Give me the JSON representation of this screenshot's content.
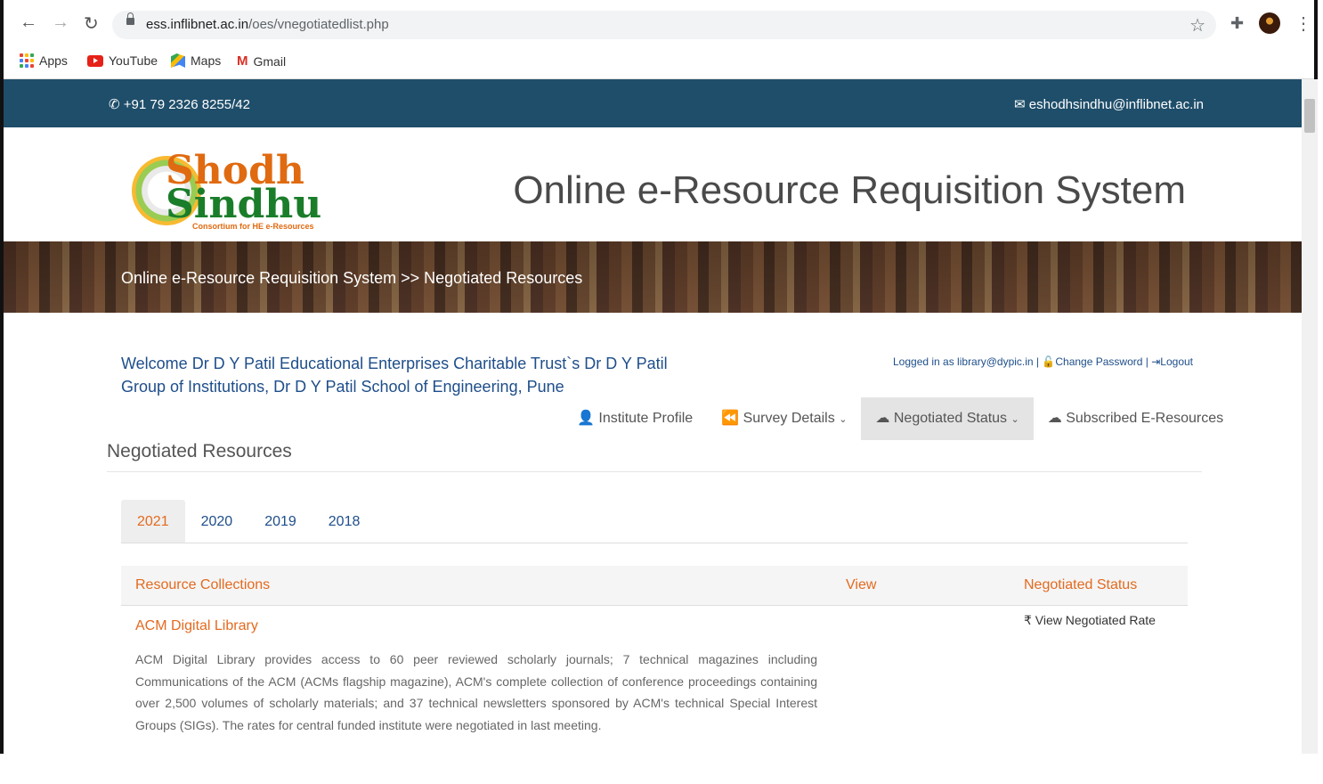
{
  "browser": {
    "url_domain": "ess.inflibnet.ac.in",
    "url_path": "/oes/vnegotiatedlist.php",
    "bookmarks": [
      "Apps",
      "YouTube",
      "Maps",
      "Gmail"
    ]
  },
  "topbar": {
    "phone": "+91 79 2326 8255/42",
    "email": "eshodhsindhu@inflibnet.ac.in"
  },
  "header": {
    "logo_primary": "Shodh",
    "logo_secondary": "Sindhu",
    "logo_sub": "Consortium for HE e-Resources",
    "site_title": "Online e-Resource Requisition System"
  },
  "breadcrumb": "Online e-Resource Requisition System >> Negotiated Resources",
  "welcome": "Welcome Dr D Y Patil Educational Enterprises Charitable Trust`s Dr D Y Patil Group of Institutions, Dr D Y Patil School of Engineering, Pune",
  "userlinks": {
    "logged_in": "Logged in as library@dypic.in |",
    "change_password": "Change Password",
    "separator": "|",
    "logout": "Logout"
  },
  "menu": [
    "Institute Profile",
    "Survey Details",
    "Negotiated Status",
    "Subscribed E-Resources"
  ],
  "section_title": "Negotiated Resources",
  "tabs": [
    "2021",
    "2020",
    "2019",
    "2018"
  ],
  "table": {
    "headers": [
      "Resource Collections",
      "View",
      "Negotiated Status"
    ],
    "rows": [
      {
        "name": "ACM Digital Library",
        "description": "ACM Digital Library provides access to 60 peer reviewed scholarly journals; 7 technical magazines including Communications of the ACM (ACMs flagship magazine), ACM's complete collection of conference proceedings containing over 2,500 volumes of scholarly materials; and 37 technical newsletters sponsored by ACM's technical Special Interest Groups (SIGs). The rates for central funded institute were negotiated in last meeting.",
        "action": "View Negotiated Rate"
      }
    ]
  },
  "colors": {
    "topbar": "#1f4e6a",
    "accent": "#e36a1f",
    "link": "#1e4e8a"
  }
}
